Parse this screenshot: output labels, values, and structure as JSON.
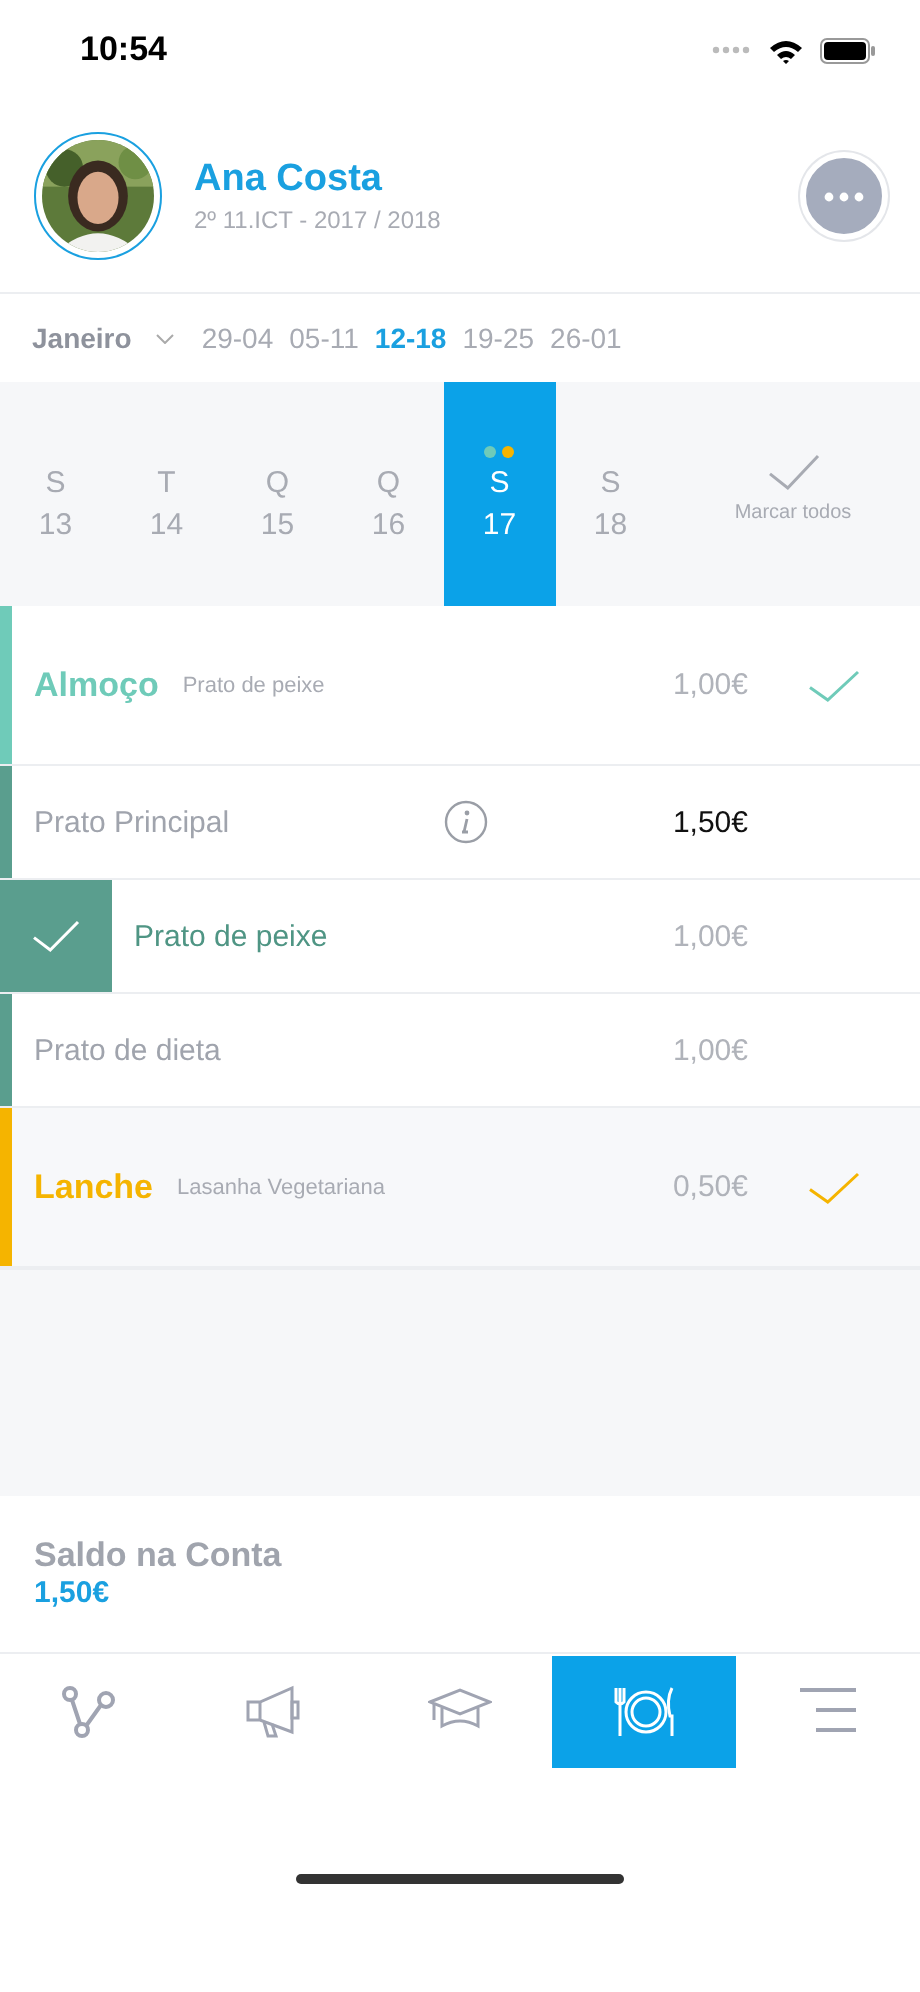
{
  "status_bar": {
    "time": "10:54"
  },
  "profile": {
    "name": "Ana Costa",
    "subtitle": "2º 11.ICT - 2017 / 2018"
  },
  "month": {
    "label": "Janeiro"
  },
  "weeks": [
    {
      "label": "29-04",
      "selected": false
    },
    {
      "label": "05-11",
      "selected": false
    },
    {
      "label": "12-18",
      "selected": true
    },
    {
      "label": "19-25",
      "selected": false
    },
    {
      "label": "26-01",
      "selected": false
    }
  ],
  "days": [
    {
      "letter": "S",
      "number": "13",
      "selected": false
    },
    {
      "letter": "T",
      "number": "14",
      "selected": false
    },
    {
      "letter": "Q",
      "number": "15",
      "selected": false
    },
    {
      "letter": "Q",
      "number": "16",
      "selected": false
    },
    {
      "letter": "S",
      "number": "17",
      "selected": true,
      "dots": [
        {
          "color": "#6fcbb9"
        },
        {
          "color": "#f5b400"
        }
      ]
    },
    {
      "letter": "S",
      "number": "18",
      "selected": false
    }
  ],
  "mark_all": {
    "label": "Marcar todos"
  },
  "meals": [
    {
      "name": "Almoço",
      "choice": "Prato de peixe",
      "price": "1,00€",
      "color": "#6fcbb9",
      "checked": true,
      "options": [
        {
          "name": "Prato Principal",
          "price": "1,50€",
          "selected": false,
          "info": true,
          "price_emphasized": true
        },
        {
          "name": "Prato de peixe",
          "price": "1,00€",
          "selected": true,
          "info": false,
          "price_emphasized": false
        },
        {
          "name": "Prato de dieta",
          "price": "1,00€",
          "selected": false,
          "info": false,
          "price_emphasized": false
        }
      ]
    },
    {
      "name": "Lanche",
      "choice": "Lasanha Vegetariana",
      "price": "0,50€",
      "color": "#f5b400",
      "checked": true
    }
  ],
  "balance": {
    "label": "Saldo na Conta",
    "value": "1,50€"
  },
  "tabs": [
    {
      "kind": "share",
      "selected": false
    },
    {
      "kind": "megaphone",
      "selected": false
    },
    {
      "kind": "graduation",
      "selected": false
    },
    {
      "kind": "meal",
      "selected": true
    },
    {
      "kind": "menu",
      "selected": false
    }
  ]
}
